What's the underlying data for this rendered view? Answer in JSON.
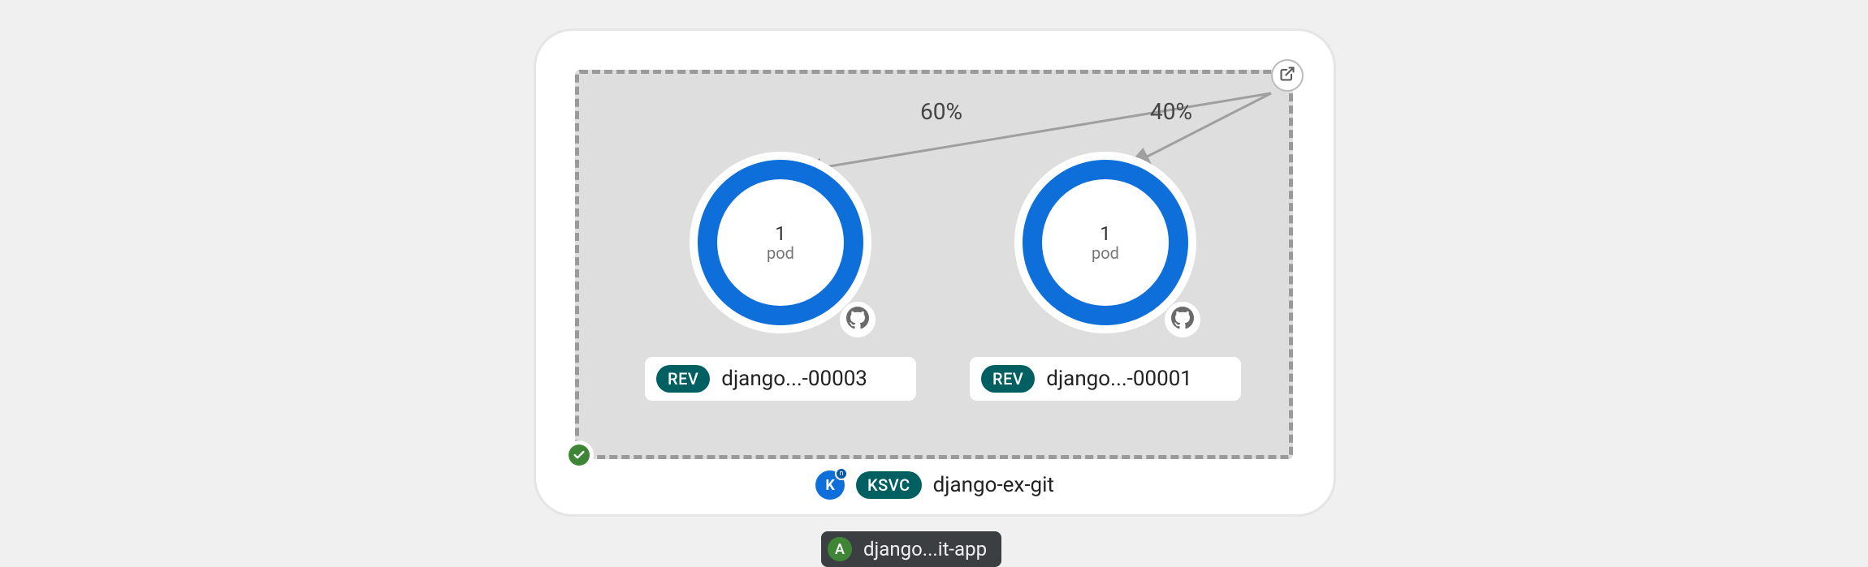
{
  "group": {
    "status": "ok"
  },
  "service": {
    "kind_badge": "KSVC",
    "name": "django-ex-git",
    "icon": "knative-icon"
  },
  "application": {
    "letter": "A",
    "name": "django...it-app"
  },
  "revisions": [
    {
      "traffic_percent": "60%",
      "pod_count": "1",
      "pod_unit": "pod",
      "kind_badge": "REV",
      "name": "django...-00003",
      "source_icon": "github-icon"
    },
    {
      "traffic_percent": "40%",
      "pod_count": "1",
      "pod_unit": "pod",
      "kind_badge": "REV",
      "name": "django...-00001",
      "source_icon": "github-icon"
    }
  ],
  "colors": {
    "ring": "#0e6fdb",
    "badge_teal": "#005f60",
    "status_green": "#3e8635",
    "app_chip_bg": "#3c3f42"
  }
}
